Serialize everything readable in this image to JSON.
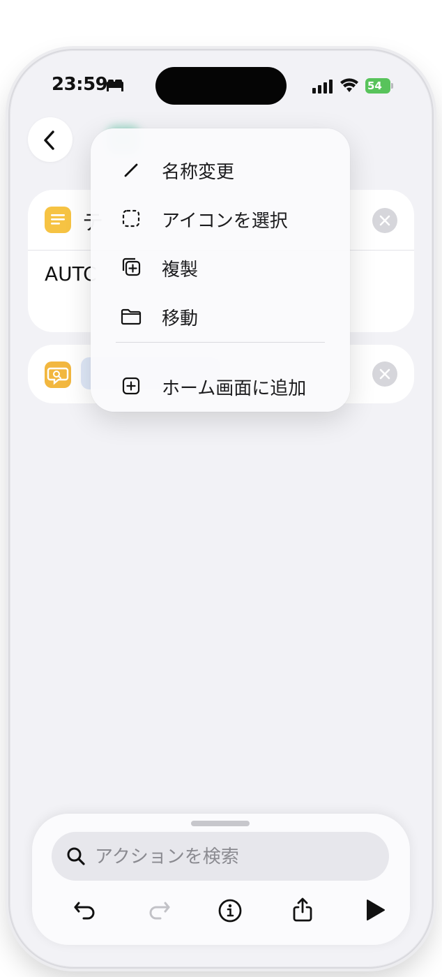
{
  "status_bar": {
    "time": "23:59",
    "battery_level": "54",
    "icons": [
      "sleep-icon",
      "cellular-signal-icon",
      "wifi-icon",
      "battery-charging-icon"
    ]
  },
  "cards": {
    "text_action": {
      "title_partial": "テ",
      "body_partial": "AUTC"
    }
  },
  "context_menu": {
    "items": [
      {
        "label": "名称変更",
        "icon": "pencil-icon"
      },
      {
        "label": "アイコンを選択",
        "icon": "dashed-square-icon"
      },
      {
        "label": "複製",
        "icon": "duplicate-icon"
      },
      {
        "label": "移動",
        "icon": "folder-icon"
      },
      {
        "label": "ホーム画面に追加",
        "icon": "add-square-icon"
      }
    ]
  },
  "bottom_sheet": {
    "search_placeholder": "アクションを検索",
    "toolbar": [
      "undo-icon",
      "redo-icon",
      "info-icon",
      "share-icon",
      "play-icon"
    ]
  },
  "colors": {
    "accent": "#f6c343",
    "battery": "#58c35b",
    "background": "#f2f2f6"
  }
}
